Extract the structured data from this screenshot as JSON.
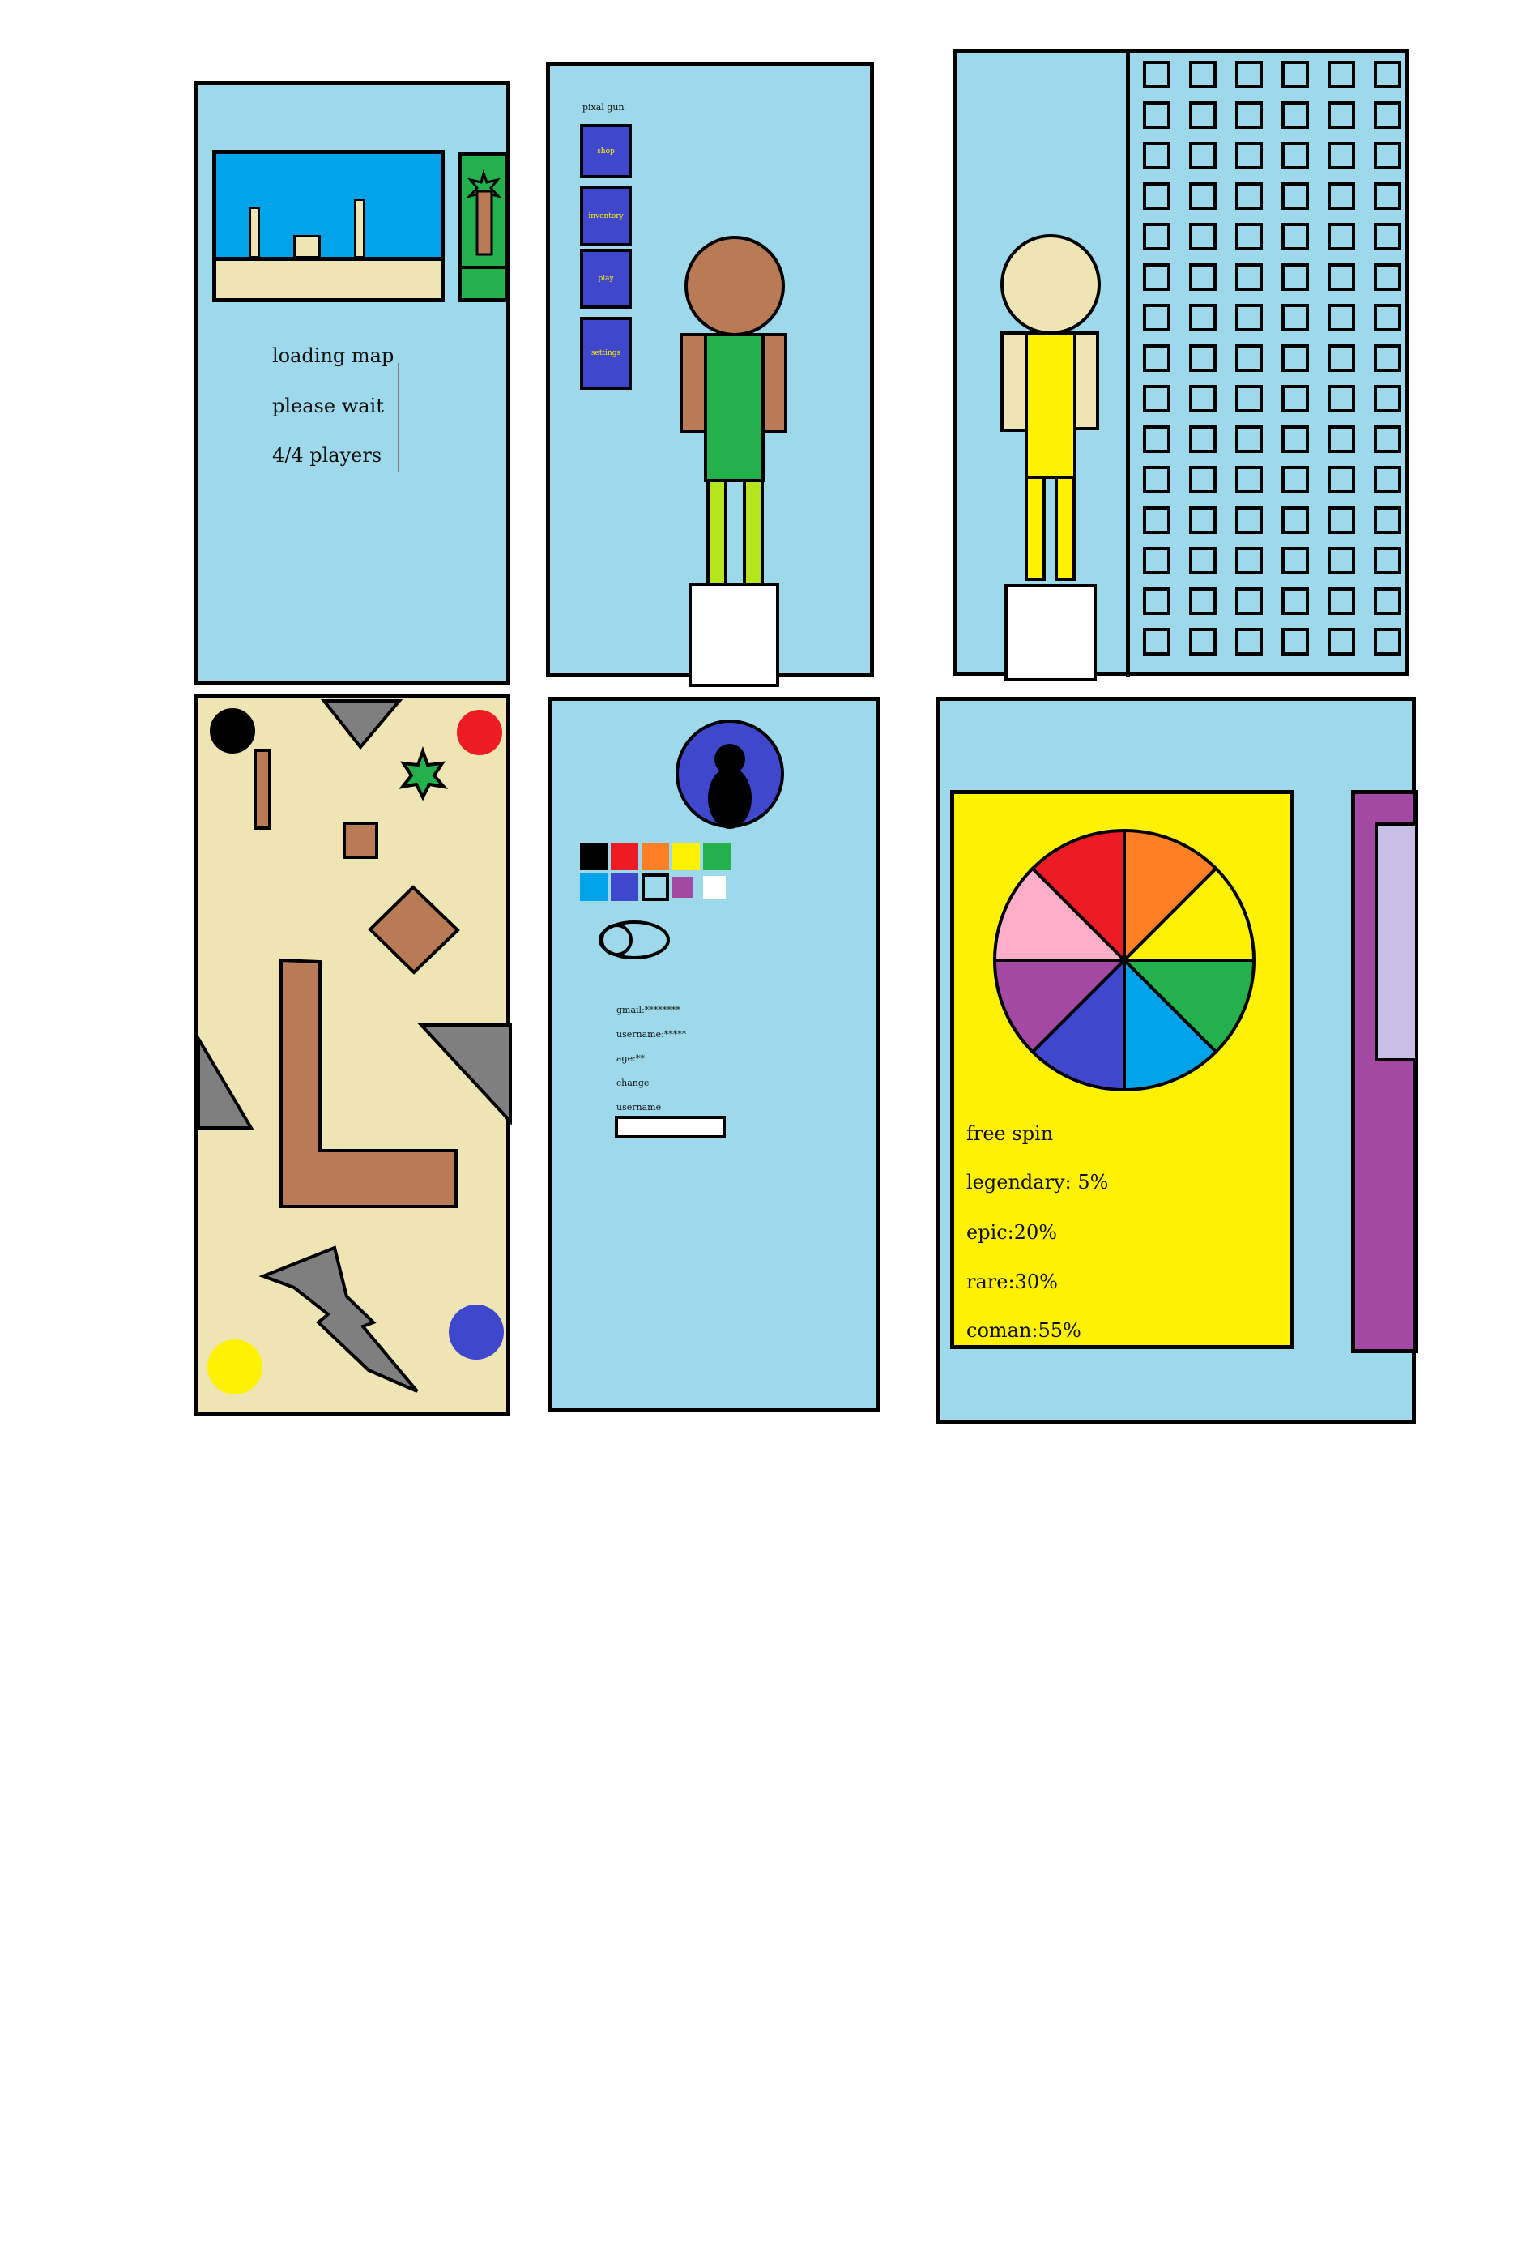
{
  "loading_screen": {
    "line1": "loading map",
    "line2": "please wait",
    "line3": "4/4 players"
  },
  "lobby_screen": {
    "title": "pixal gun",
    "menu_buttons": [
      "shop",
      "inventory",
      "play",
      "settings"
    ]
  },
  "skins_screen": {
    "grid_rows": 15,
    "grid_cols": 6
  },
  "map_screen": {
    "items": [
      "black-dot",
      "red-dot",
      "green-star",
      "blue-dot",
      "yellow-dot",
      "gray-triangle",
      "lightning-bolt",
      "brown-wall"
    ]
  },
  "profile_screen": {
    "fields": [
      "gmail:********",
      "username:*****",
      "age:**",
      "change",
      "username"
    ],
    "color_swatches": [
      "#000000",
      "#ed1c24",
      "#ff7f27",
      "#fff200",
      "#22b14c",
      "#00a2e8",
      "#3f48cc",
      "#9dd9ea",
      "#a349a4",
      "#ffffff"
    ]
  },
  "spin_screen": {
    "title": "free spin",
    "odds": [
      "legendary: 5%",
      "epic:20%",
      "rare:30%",
      "coman:55%"
    ],
    "wheel_colors": [
      "#ff7f27",
      "#fff200",
      "#22b14c",
      "#00a2e8",
      "#3f48cc",
      "#a349a4",
      "#ffaec9",
      "#ed1c24"
    ]
  }
}
